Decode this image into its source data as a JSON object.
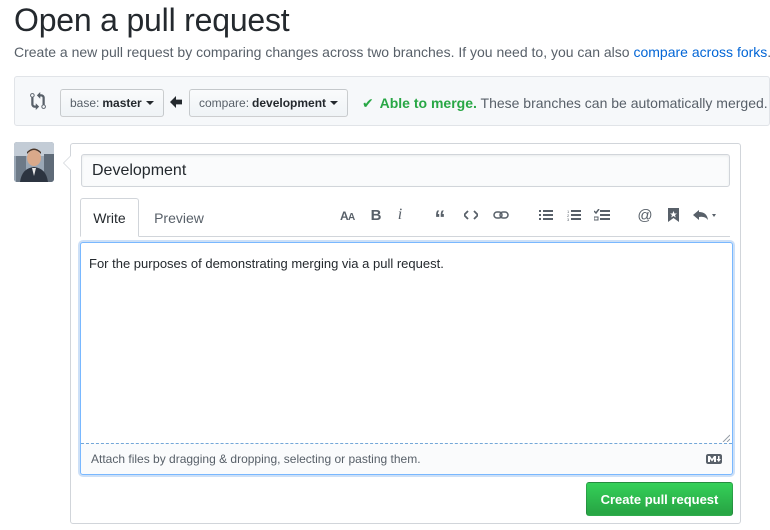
{
  "page": {
    "title": "Open a pull request",
    "subtitle": "Create a new pull request by comparing changes across two branches. If you need to, you can also ",
    "subtitle_link": "compare across forks",
    "subtitle_end": "."
  },
  "compare": {
    "base_prefix": "base:",
    "base_branch": "master",
    "compare_prefix": "compare:",
    "compare_branch": "development",
    "merge_ok": "Able to merge.",
    "merge_detail": " These branches can be automatically merged."
  },
  "form": {
    "title_value": "Development",
    "tabs": [
      "Write",
      "Preview"
    ],
    "body_text": "For the purposes of demonstrating merging via a pull request.",
    "attach_text": "Attach files by dragging & dropping, selecting or pasting them.",
    "submit_label": "Create pull request"
  },
  "toolbar": {
    "icons": [
      "text-size-icon",
      "bold-icon",
      "italic-icon",
      "quote-icon",
      "code-icon",
      "link-icon",
      "unordered-list-icon",
      "ordered-list-icon",
      "task-list-icon",
      "mention-icon",
      "saved-reply-icon",
      "reply-icon"
    ]
  },
  "colors": {
    "accent_green": "#28a745",
    "link_blue": "#0366d6",
    "focus_blue": "#79b8ff"
  }
}
